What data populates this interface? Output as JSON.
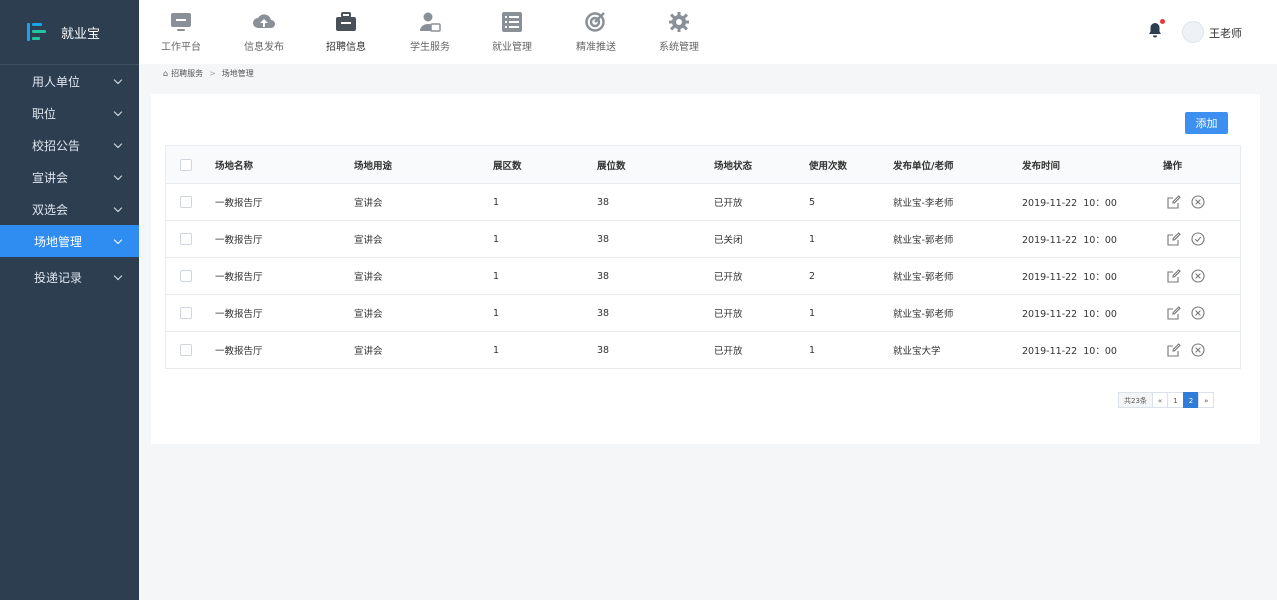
{
  "app": {
    "name": "就业宝"
  },
  "sidebar": {
    "items": [
      {
        "label": "用人单位"
      },
      {
        "label": "职位"
      },
      {
        "label": "校招公告"
      },
      {
        "label": "宣讲会"
      },
      {
        "label": "双选会"
      },
      {
        "label": "场地管理",
        "active": true
      },
      {
        "label": "投递记录"
      }
    ]
  },
  "topnav": {
    "items": [
      {
        "label": "工作平台",
        "icon": "monitor-icon"
      },
      {
        "label": "信息发布",
        "icon": "cloud-upload-icon"
      },
      {
        "label": "招聘信息",
        "icon": "briefcase-icon",
        "active": true
      },
      {
        "label": "学生服务",
        "icon": "user-card-icon"
      },
      {
        "label": "就业管理",
        "icon": "list-icon"
      },
      {
        "label": "精准推送",
        "icon": "target-icon"
      },
      {
        "label": "系统管理",
        "icon": "gear-icon"
      }
    ],
    "user": {
      "name": "王老师"
    }
  },
  "breadcrumb": {
    "parent": "招聘服务",
    "current": "场地管理"
  },
  "toolbar": {
    "add_label": "添加"
  },
  "table": {
    "headers": {
      "name": "场地名称",
      "usage": "场地用途",
      "zones": "展区数",
      "booths": "展位数",
      "status": "场地状态",
      "uses": "使用次数",
      "publisher": "发布单位/老师",
      "time": "发布时间",
      "ops": "操作"
    },
    "rows": [
      {
        "name": "一教报告厅",
        "usage": "宣讲会",
        "zones": "1",
        "booths": "38",
        "status": "已开放",
        "uses": "5",
        "publisher": "就业宝-李老师",
        "time": "2019-11-22  10：00",
        "action_icon": "close-circle-icon"
      },
      {
        "name": "一教报告厅",
        "usage": "宣讲会",
        "zones": "1",
        "booths": "38",
        "status": "已关闭",
        "uses": "1",
        "publisher": "就业宝-郭老师",
        "time": "2019-11-22  10：00",
        "action_icon": "check-circle-icon"
      },
      {
        "name": "一教报告厅",
        "usage": "宣讲会",
        "zones": "1",
        "booths": "38",
        "status": "已开放",
        "uses": "2",
        "publisher": "就业宝-郭老师",
        "time": "2019-11-22  10：00",
        "action_icon": "close-circle-icon"
      },
      {
        "name": "一教报告厅",
        "usage": "宣讲会",
        "zones": "1",
        "booths": "38",
        "status": "已开放",
        "uses": "1",
        "publisher": "就业宝-郭老师",
        "time": "2019-11-22  10：00",
        "action_icon": "close-circle-icon"
      },
      {
        "name": "一教报告厅",
        "usage": "宣讲会",
        "zones": "1",
        "booths": "38",
        "status": "已开放",
        "uses": "1",
        "publisher": "就业宝大学",
        "time": "2019-11-22  10：00",
        "action_icon": "close-circle-icon"
      }
    ]
  },
  "pagination": {
    "total": "共23条",
    "prev": "«",
    "pages": [
      "1",
      "2"
    ],
    "current": "2",
    "next": "»"
  },
  "colors": {
    "sidebar": "#2c3e50",
    "accent": "#2f8cf0",
    "button": "#3d8ff0",
    "badge": "#e6393a"
  }
}
